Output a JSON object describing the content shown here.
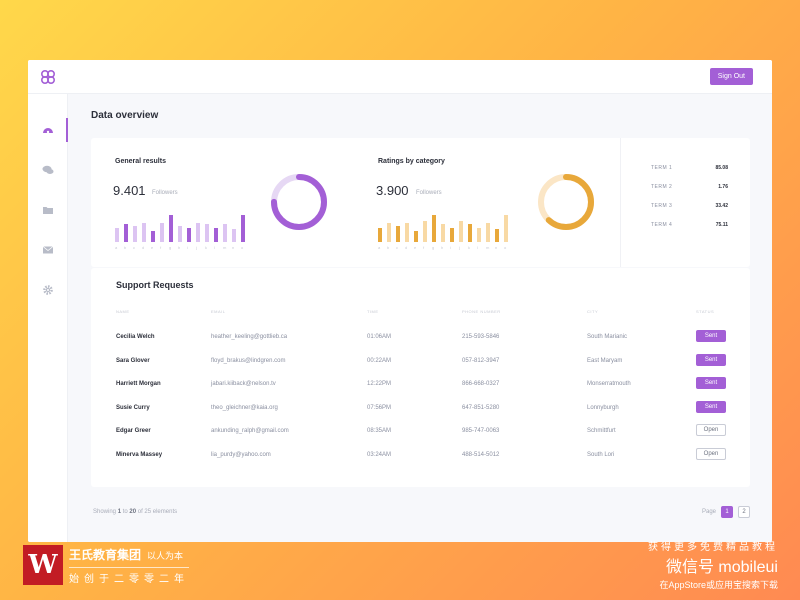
{
  "topbar": {
    "signout_label": "Sign Out"
  },
  "sidebar": {
    "icons": [
      "dashboard-icon",
      "chat-icon",
      "folder-icon",
      "mail-icon",
      "gear-icon"
    ]
  },
  "page": {
    "title": "Data overview"
  },
  "general": {
    "title": "General results",
    "value": "9.401",
    "unit": "Followers",
    "donut_fraction": 0.75,
    "bar_labels": [
      "a",
      "b",
      "c",
      "d",
      "e",
      "f",
      "g",
      "h",
      "i",
      "j",
      "k",
      "l",
      "m",
      "n",
      "o"
    ],
    "bar_values": [
      0.45,
      0.55,
      0.5,
      0.6,
      0.35,
      0.6,
      0.85,
      0.5,
      0.45,
      0.6,
      0.55,
      0.45,
      0.55,
      0.4,
      0.85
    ],
    "bar_dark": [
      false,
      true,
      false,
      false,
      true,
      false,
      true,
      false,
      true,
      false,
      false,
      true,
      false,
      false,
      true
    ],
    "color_dark": "#a35fd6",
    "color_light": "#dcc4f2"
  },
  "ratings": {
    "title": "Ratings by category",
    "value": "3.900",
    "unit": "Followers",
    "donut_fraction": 0.62,
    "bar_labels": [
      "a",
      "b",
      "c",
      "d",
      "e",
      "f",
      "g",
      "h",
      "i",
      "j",
      "k",
      "l",
      "m",
      "n",
      "o"
    ],
    "bar_values": [
      0.45,
      0.6,
      0.5,
      0.6,
      0.35,
      0.65,
      0.85,
      0.55,
      0.45,
      0.65,
      0.55,
      0.45,
      0.6,
      0.4,
      0.85
    ],
    "bar_dark": [
      true,
      false,
      true,
      false,
      true,
      false,
      true,
      false,
      true,
      false,
      true,
      false,
      false,
      true,
      false
    ],
    "color_dark": "#e8a83a",
    "color_light": "#f8d9a4"
  },
  "terms": [
    {
      "label": "TERM 1",
      "value": "85.08"
    },
    {
      "label": "TERM 2",
      "value": "1.76"
    },
    {
      "label": "TERM 3",
      "value": "33.42"
    },
    {
      "label": "TERM 4",
      "value": "75.11"
    }
  ],
  "support": {
    "title": "Support Requests",
    "headers": [
      "NAME",
      "EMAIL",
      "TIME",
      "PHONE NUMBER",
      "CITY",
      "STATUS"
    ],
    "rows": [
      {
        "name": "Cecilia Welch",
        "email": "heather_keeling@gottlieb.ca",
        "time": "01:06AM",
        "phone": "215-593-5846",
        "city": "South Marianic",
        "status": "Sent"
      },
      {
        "name": "Sara Glover",
        "email": "floyd_brakus@lindgren.com",
        "time": "00:22AM",
        "phone": "057-812-3947",
        "city": "East Maryam",
        "status": "Sent"
      },
      {
        "name": "Harriett Morgan",
        "email": "jabari.kiiback@nelson.tv",
        "time": "12:22PM",
        "phone": "866-668-0327",
        "city": "Monserratmouth",
        "status": "Sent"
      },
      {
        "name": "Susie Curry",
        "email": "theo_gleichner@kaia.org",
        "time": "07:56PM",
        "phone": "647-851-5280",
        "city": "Lonnyburgh",
        "status": "Sent"
      },
      {
        "name": "Edgar Greer",
        "email": "ankunding_ralph@gmail.com",
        "time": "08:35AM",
        "phone": "985-747-0063",
        "city": "Schmittfurt",
        "status": "Open"
      },
      {
        "name": "Minerva Massey",
        "email": "lia_purdy@yahoo.com",
        "time": "03:24AM",
        "phone": "488-514-5012",
        "city": "South Lori",
        "status": "Open"
      }
    ]
  },
  "footer": {
    "showing_prefix": "Showing",
    "from": "1",
    "to_word": "to",
    "to": "20",
    "of_text": "of 25 elements",
    "page_label": "Page",
    "pages": [
      "1",
      "2"
    ]
  },
  "watermark": {
    "brand_name": "王氏教育集团",
    "brand_slogan": "以人为本",
    "brand_since": "始创于二零零二年",
    "logo_letter": "W",
    "right_line1": "获得更多免费精品教程",
    "right_line2": "微信号 mobileui",
    "right_line3": "在AppStore或应用宝搜索下载"
  }
}
